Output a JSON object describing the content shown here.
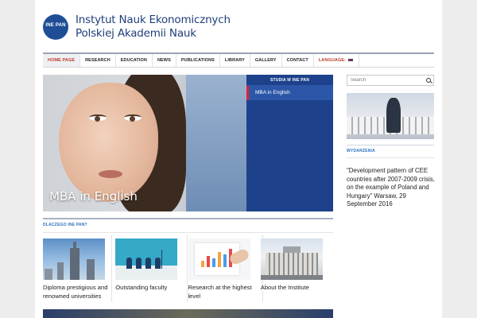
{
  "header": {
    "logo_text": "INE PAN",
    "title_line1": "Instytut Nauk Ekonomicznych",
    "title_line2": "Polskiej Akademii Nauk"
  },
  "nav": {
    "items": [
      {
        "label": "HOME PAGE"
      },
      {
        "label": "RESEARCH"
      },
      {
        "label": "EDUCATION"
      },
      {
        "label": "NEWS"
      },
      {
        "label": "PUBLICATIONS"
      },
      {
        "label": "LIBRARY"
      },
      {
        "label": "GALLERY"
      },
      {
        "label": "CONTACT"
      },
      {
        "label": "LANGUAGE:"
      }
    ],
    "active_color": "#c0392b"
  },
  "slider": {
    "caption": "MBA in English",
    "panel_heading": "STUDIA W INE PAN",
    "panel_items": [
      {
        "label": "MBA in English"
      }
    ],
    "panel_color": "#1d418b"
  },
  "sidebar": {
    "search_placeholder": "Search",
    "section_label": "WYDARZENIA",
    "event_text": "\"Development pattern of CEE countries after 2007-2009 crisis, on the example of Poland and Hungary\" Warsaw, 29 September 2016"
  },
  "why_section": {
    "label": "DLACZEGO INE PAN?",
    "cards": [
      {
        "text": "Diploma prestigious and renowned universities"
      },
      {
        "text": "Outstanding faculty"
      },
      {
        "text": "Research at the highest level"
      },
      {
        "text": "About the Institute"
      }
    ]
  },
  "colors": {
    "brand_blue": "#1f4e96",
    "accent_red": "#c0392b",
    "link_blue": "#2a6fbf"
  }
}
